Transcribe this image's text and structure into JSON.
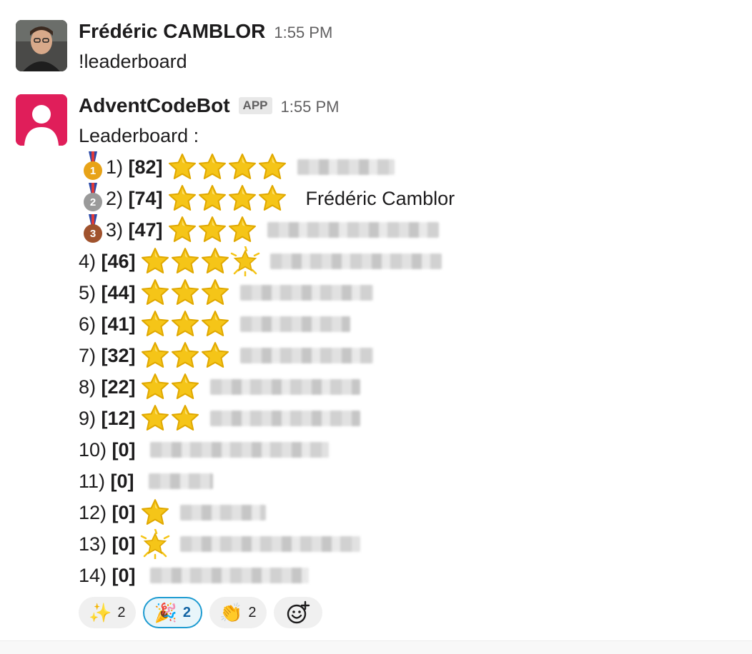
{
  "messages": [
    {
      "sender": "Frédéric CAMBLOR",
      "time": "1:55 PM",
      "text": "!leaderboard"
    },
    {
      "sender": "AdventCodeBot",
      "badge": "APP",
      "time": "1:55 PM",
      "text": "Leaderboard :"
    }
  ],
  "leaderboard": [
    {
      "rank": "1)",
      "score": "[82]",
      "medal": "gold",
      "medal_digit": "1",
      "stars": "4 full",
      "name": ""
    },
    {
      "rank": "2)",
      "score": "[74]",
      "medal": "silver",
      "medal_digit": "2",
      "stars": "4 full",
      "name": "Frédéric Camblor"
    },
    {
      "rank": "3)",
      "score": "[47]",
      "medal": "bronze",
      "medal_digit": "3",
      "stars": "3 full",
      "name": ""
    },
    {
      "rank": "4)",
      "score": "[46]",
      "stars": "3 full + 1 glowing",
      "name": ""
    },
    {
      "rank": "5)",
      "score": "[44]",
      "stars": "3 full",
      "name": ""
    },
    {
      "rank": "6)",
      "score": "[41]",
      "stars": "3 full",
      "name": ""
    },
    {
      "rank": "7)",
      "score": "[32]",
      "stars": "3 full",
      "name": ""
    },
    {
      "rank": "8)",
      "score": "[22]",
      "stars": "2 full",
      "name": ""
    },
    {
      "rank": "9)",
      "score": "[12]",
      "stars": "2 full",
      "name": ""
    },
    {
      "rank": "10)",
      "score": "[0]",
      "stars": "none",
      "name": ""
    },
    {
      "rank": "11)",
      "score": "[0]",
      "stars": "none",
      "name": ""
    },
    {
      "rank": "12)",
      "score": "[0]",
      "stars": "1 full",
      "name": ""
    },
    {
      "rank": "13)",
      "score": "[0]",
      "stars": "1 glowing",
      "name": ""
    },
    {
      "rank": "14)",
      "score": "[0]",
      "stars": "none",
      "name": ""
    }
  ],
  "reactions": [
    {
      "icon": "sparkles-icon",
      "emoji": "✨",
      "count": "2",
      "active": false
    },
    {
      "icon": "party-popper-icon",
      "emoji": "🎉",
      "count": "2",
      "active": true
    },
    {
      "icon": "clapping-hands-icon",
      "emoji": "👏",
      "count": "2",
      "active": false
    }
  ],
  "colors": {
    "bot_avatar": "#e01e5a",
    "gold": "#e8a317",
    "silver": "#9a9a9a",
    "bronze": "#a0522d",
    "star": "#f5c518",
    "active_reaction_border": "#1d9bd1"
  }
}
